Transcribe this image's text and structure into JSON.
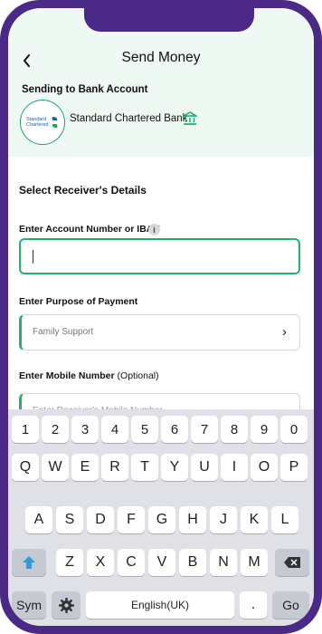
{
  "header": {
    "title": "Send Money",
    "back_icon": "chevron-left-icon"
  },
  "recipient_bank": {
    "section_label": "Sending to Bank Account",
    "logo_text_line1": "Standard",
    "logo_text_line2": "Chartered",
    "bank_name": "Standard Chartered Bank",
    "bank_icon": "bank-building-icon",
    "brand_color": "#15a36b"
  },
  "form": {
    "section_title": "Select Receiver's Details",
    "account": {
      "label": "Enter Account Number or IBAN",
      "info_icon_text": "i",
      "value": ""
    },
    "purpose": {
      "label": "Enter Purpose of Payment",
      "value": "Family Support",
      "chevron": "›"
    },
    "mobile": {
      "label": "Enter Mobile Number",
      "optional": "(Optional)",
      "placeholder": "Enter Receiver's Mobile Number"
    }
  },
  "keyboard": {
    "numbers": [
      "1",
      "2",
      "3",
      "4",
      "5",
      "6",
      "7",
      "8",
      "9",
      "0"
    ],
    "row1": [
      "Q",
      "W",
      "E",
      "R",
      "T",
      "Y",
      "U",
      "I",
      "O",
      "P"
    ],
    "row2": [
      "A",
      "S",
      "D",
      "F",
      "G",
      "H",
      "J",
      "K",
      "L"
    ],
    "row3": [
      "Z",
      "X",
      "C",
      "V",
      "B",
      "N",
      "M"
    ],
    "sym": "Sym",
    "space": "English(UK)",
    "period": ".",
    "go": "Go",
    "shift_icon": "shift-arrow-icon",
    "backspace_icon": "backspace-icon",
    "settings_icon": "gear-icon",
    "shift_color": "#2e9bd6"
  }
}
